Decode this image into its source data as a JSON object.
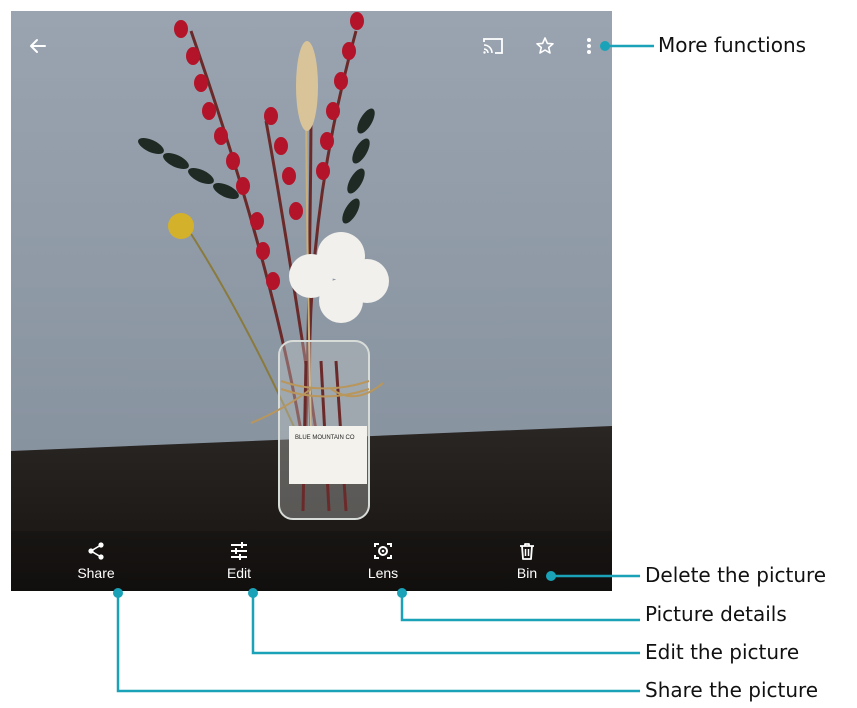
{
  "viewer": {
    "back_icon": "arrow-left-icon",
    "cast_icon": "cast-icon",
    "favorite_icon": "star-outline-icon",
    "more_icon": "more-vertical-icon",
    "photo_label_text": "BLUE MOUNTAIN CO"
  },
  "toolbar": {
    "share_label": "Share",
    "edit_label": "Edit",
    "lens_label": "Lens",
    "bin_label": "Bin"
  },
  "callouts": {
    "more_functions": "More functions",
    "delete_picture": "Delete the picture",
    "picture_details": "Picture details",
    "edit_picture": "Edit the picture",
    "share_picture": "Share the picture"
  },
  "colors": {
    "callout_line": "#1aa3b8",
    "icon_white": "#ffffff"
  }
}
